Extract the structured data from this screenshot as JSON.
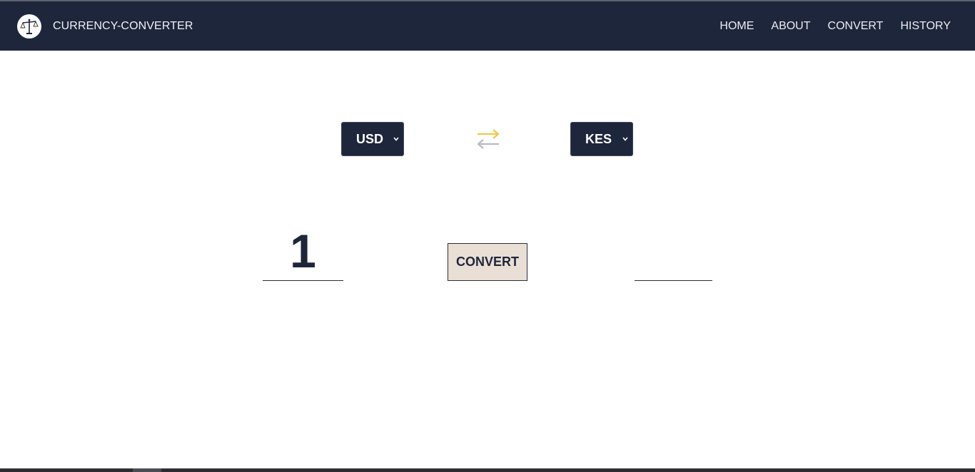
{
  "header": {
    "brand_title": "CURRENCY-CONVERTER",
    "logo_icon": "scales-icon",
    "nav": [
      {
        "label": "HOME"
      },
      {
        "label": "ABOUT"
      },
      {
        "label": "CONVERT"
      },
      {
        "label": "HISTORY"
      }
    ]
  },
  "converter": {
    "from_currency": "USD",
    "to_currency": "KES",
    "swap_icon": "swap-arrows-icon",
    "amount": "1",
    "convert_label": "CONVERT",
    "result": ""
  },
  "colors": {
    "navbar": "#1e263b",
    "button_bg": "#eadfd5",
    "swap_arrow_top": "#f0c84a",
    "swap_arrow_bottom": "#b9bcc3"
  }
}
